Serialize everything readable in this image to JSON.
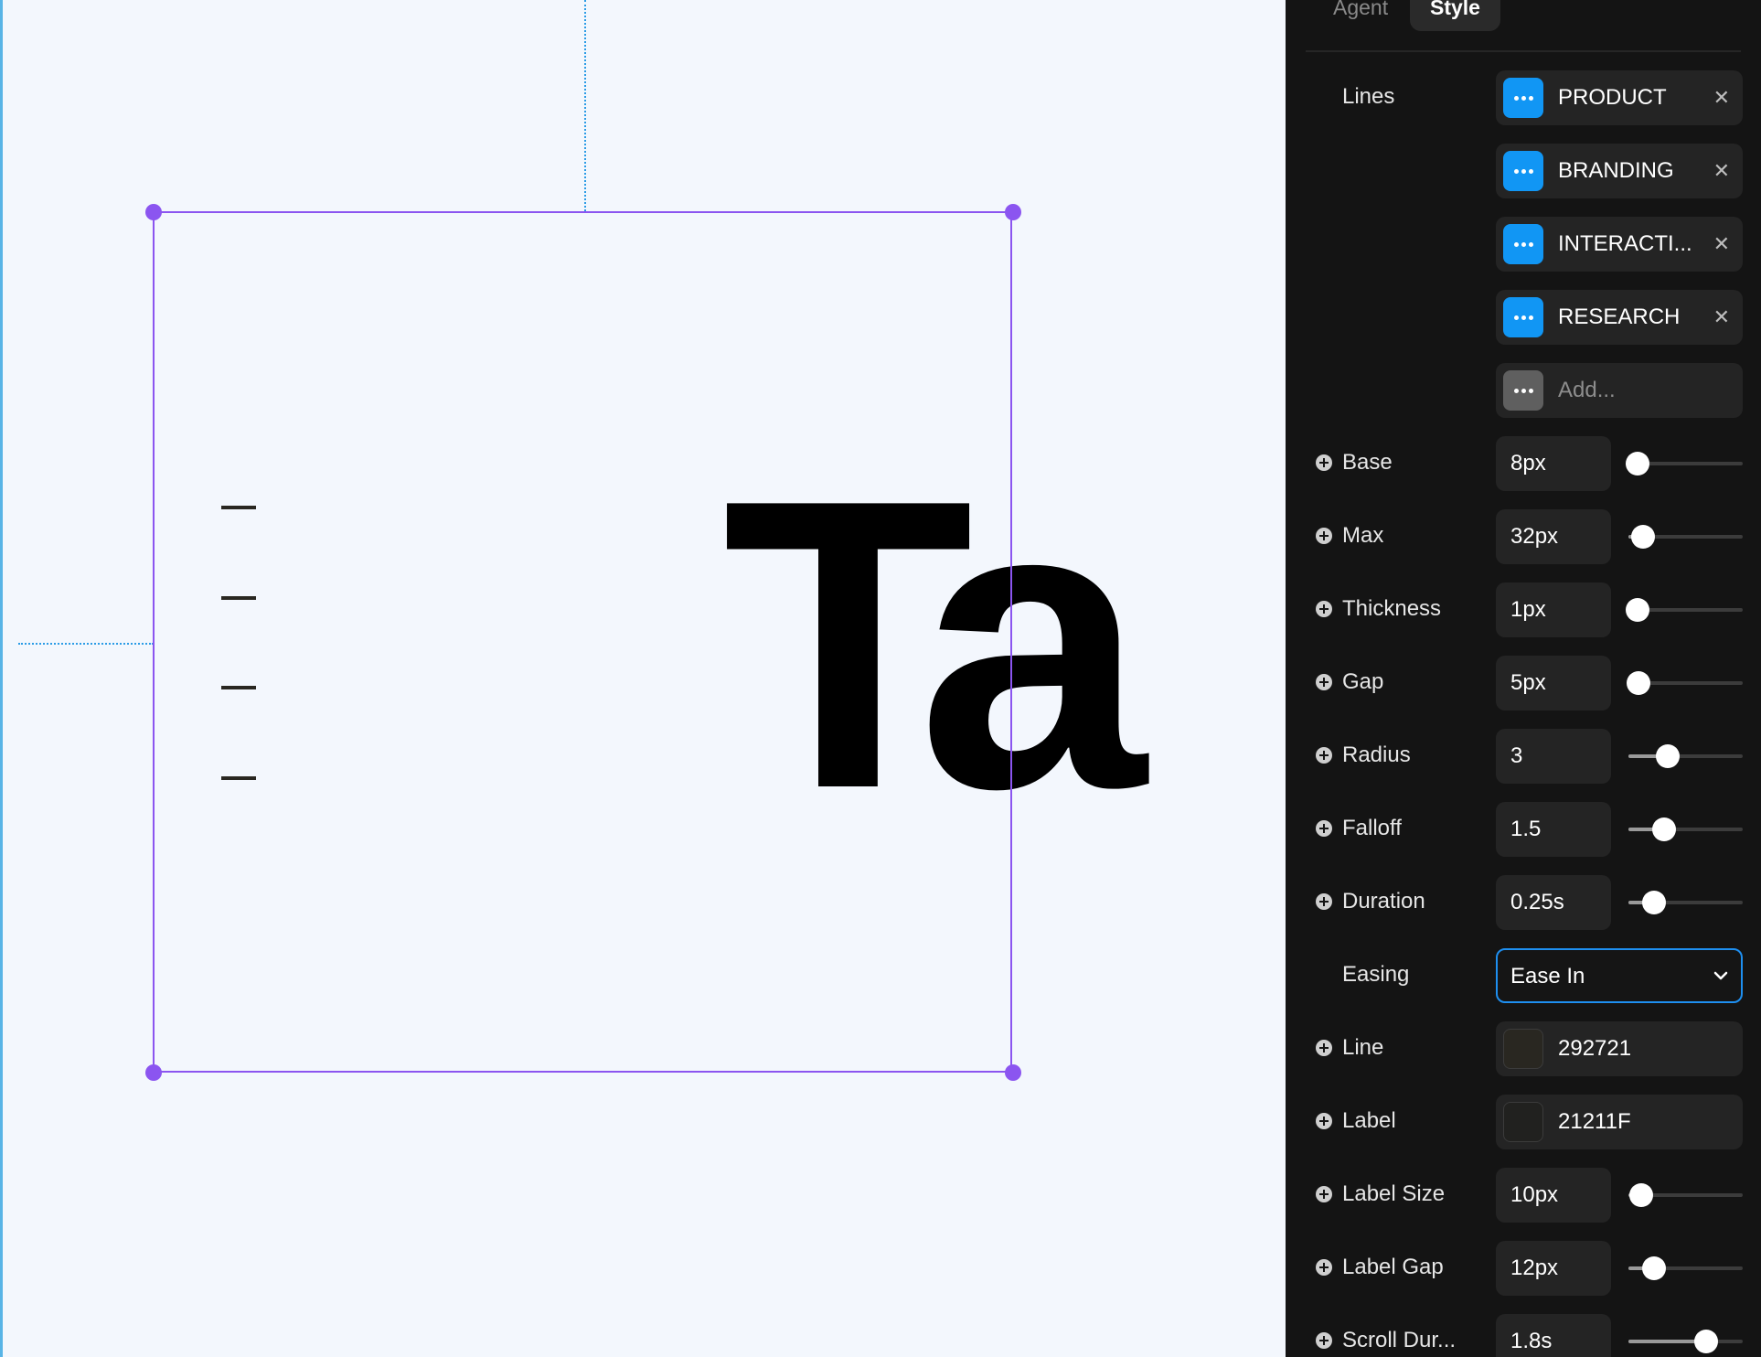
{
  "canvas": {
    "big_text": "Ta",
    "background_color": "#f3f7fd",
    "selection_color": "#8b55f0",
    "guide_color": "#2b9ce6"
  },
  "panel": {
    "tabs": [
      {
        "label": "Agent",
        "active": false
      },
      {
        "label": "Style",
        "active": true
      }
    ],
    "lines": {
      "label": "Lines",
      "items": [
        {
          "label": "PRODUCT"
        },
        {
          "label": "BRANDING"
        },
        {
          "label": "INTERACTI..."
        },
        {
          "label": "RESEARCH"
        }
      ],
      "add_placeholder": "Add...",
      "remove_icon": "close-icon",
      "item_icon": "more-dots-icon",
      "icon_color": "#1196f4"
    },
    "settings": [
      {
        "label": "Base",
        "value": "8px",
        "slider": 0.08
      },
      {
        "label": "Max",
        "value": "32px",
        "slider": 0.13
      },
      {
        "label": "Thickness",
        "value": "1px",
        "slider": 0.08
      },
      {
        "label": "Gap",
        "value": "5px",
        "slider": 0.09
      },
      {
        "label": "Radius",
        "value": "3",
        "slider": 0.34
      },
      {
        "label": "Falloff",
        "value": "1.5",
        "slider": 0.31
      },
      {
        "label": "Duration",
        "value": "0.25s",
        "slider": 0.22
      }
    ],
    "easing": {
      "label": "Easing",
      "value": "Ease In",
      "icon": "chevron-down-icon",
      "border_color": "#1e8ff0"
    },
    "colors": [
      {
        "label": "Line",
        "value": "292721",
        "swatch": "#292721"
      },
      {
        "label": "Label",
        "value": "21211F",
        "swatch": "#21211f"
      }
    ],
    "settings2": [
      {
        "label": "Label Size",
        "value": "10px",
        "slider": 0.11
      },
      {
        "label": "Label Gap",
        "value": "12px",
        "slider": 0.22
      },
      {
        "label": "Scroll Dur...",
        "value": "1.8s",
        "slider": 0.68
      }
    ]
  }
}
